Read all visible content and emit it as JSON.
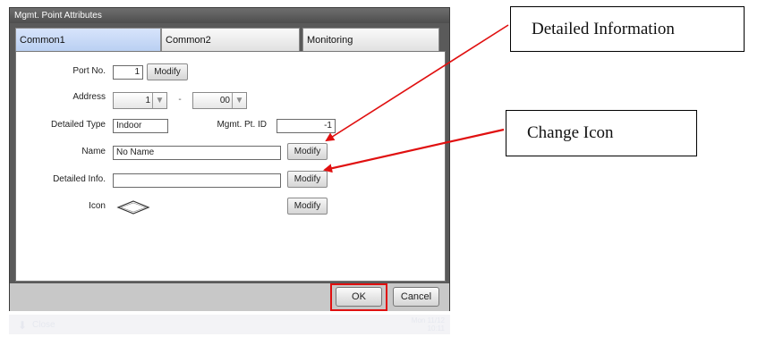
{
  "dialog": {
    "title": "Mgmt. Point Attributes",
    "tabs": [
      {
        "label": "Common1",
        "active": true
      },
      {
        "label": "Common2",
        "active": false
      },
      {
        "label": "Monitoring",
        "active": false
      }
    ]
  },
  "form": {
    "port_no": {
      "label": "Port No.",
      "value": "1",
      "button": "Modify"
    },
    "address": {
      "label": "Address",
      "value1": "1",
      "separator": "-",
      "value2": "00"
    },
    "detailed_type": {
      "label": "Detailed Type",
      "value": "Indoor"
    },
    "mgmt_pt_id": {
      "label": "Mgmt. Pt. ID",
      "value": "-1"
    },
    "name": {
      "label": "Name",
      "value": "No Name",
      "button": "Modify"
    },
    "detailed_info": {
      "label": "Detailed Info.",
      "value": "",
      "button": "Modify"
    },
    "icon": {
      "label": "Icon",
      "button": "Modify"
    }
  },
  "footer": {
    "ok_label": "OK",
    "cancel_label": "Cancel"
  },
  "bottom_bar": {
    "close_label": "Close",
    "time_text": "Mon 11/12",
    "date_text": "10:11"
  },
  "annotations": {
    "detailed_information": "Detailed Information",
    "change_icon": "Change Icon"
  },
  "colors": {
    "highlight_red": "#e01010",
    "arrow_red": "#e01010",
    "tab_active": "#c6d8f7"
  }
}
